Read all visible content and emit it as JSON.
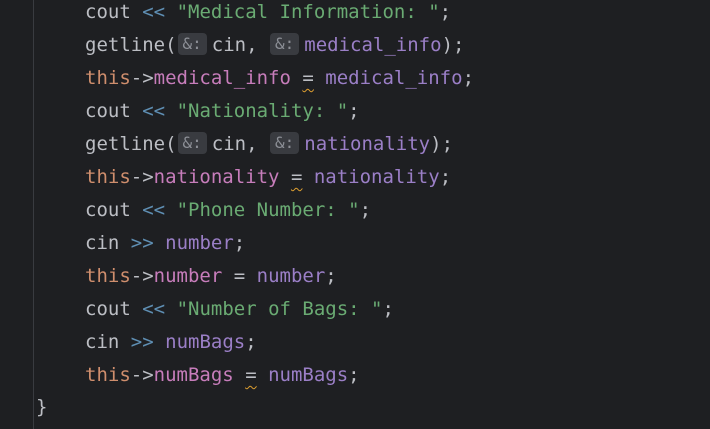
{
  "editor": {
    "lines": [
      {
        "kind": "cout",
        "obj": "cout",
        "op": "<<",
        "str": "\"Medical Information: \"",
        "end": ";"
      },
      {
        "kind": "getline",
        "fn": "getline",
        "open": "(",
        "hint1": "&:",
        "arg1": "cin",
        "sep": ",",
        "hint2": "&:",
        "arg2": "medical_info",
        "close": ")",
        "end": ";"
      },
      {
        "kind": "assign",
        "this": "this",
        "arrow": "->",
        "field": "medical_info",
        "eq": "=",
        "val": "medical_info",
        "end": ";"
      },
      {
        "kind": "cout",
        "obj": "cout",
        "op": "<<",
        "str": "\"Nationality: \"",
        "end": ";"
      },
      {
        "kind": "getline",
        "fn": "getline",
        "open": "(",
        "hint1": "&:",
        "arg1": "cin",
        "sep": ",",
        "hint2": "&:",
        "arg2": "nationality",
        "close": ")",
        "end": ";"
      },
      {
        "kind": "assign",
        "this": "this",
        "arrow": "->",
        "field": "nationality",
        "eq": "=",
        "val": "nationality",
        "end": ";"
      },
      {
        "kind": "cout",
        "obj": "cout",
        "op": "<<",
        "str": "\"Phone Number: \"",
        "end": ";"
      },
      {
        "kind": "cin",
        "obj": "cin",
        "op": ">>",
        "var": "number",
        "end": ";"
      },
      {
        "kind": "assign",
        "this": "this",
        "arrow": "->",
        "field": "number",
        "eq": "=",
        "val": "number",
        "end": ";"
      },
      {
        "kind": "cout",
        "obj": "cout",
        "op": "<<",
        "str": "\"Number of Bags: \"",
        "end": ";"
      },
      {
        "kind": "cin",
        "obj": "cin",
        "op": ">>",
        "var": "numBags",
        "end": ";"
      },
      {
        "kind": "assign",
        "this": "this",
        "arrow": "->",
        "field": "numBags",
        "eq": "=",
        "val": "numBags",
        "end": ";"
      }
    ],
    "closing_brace": "}"
  }
}
